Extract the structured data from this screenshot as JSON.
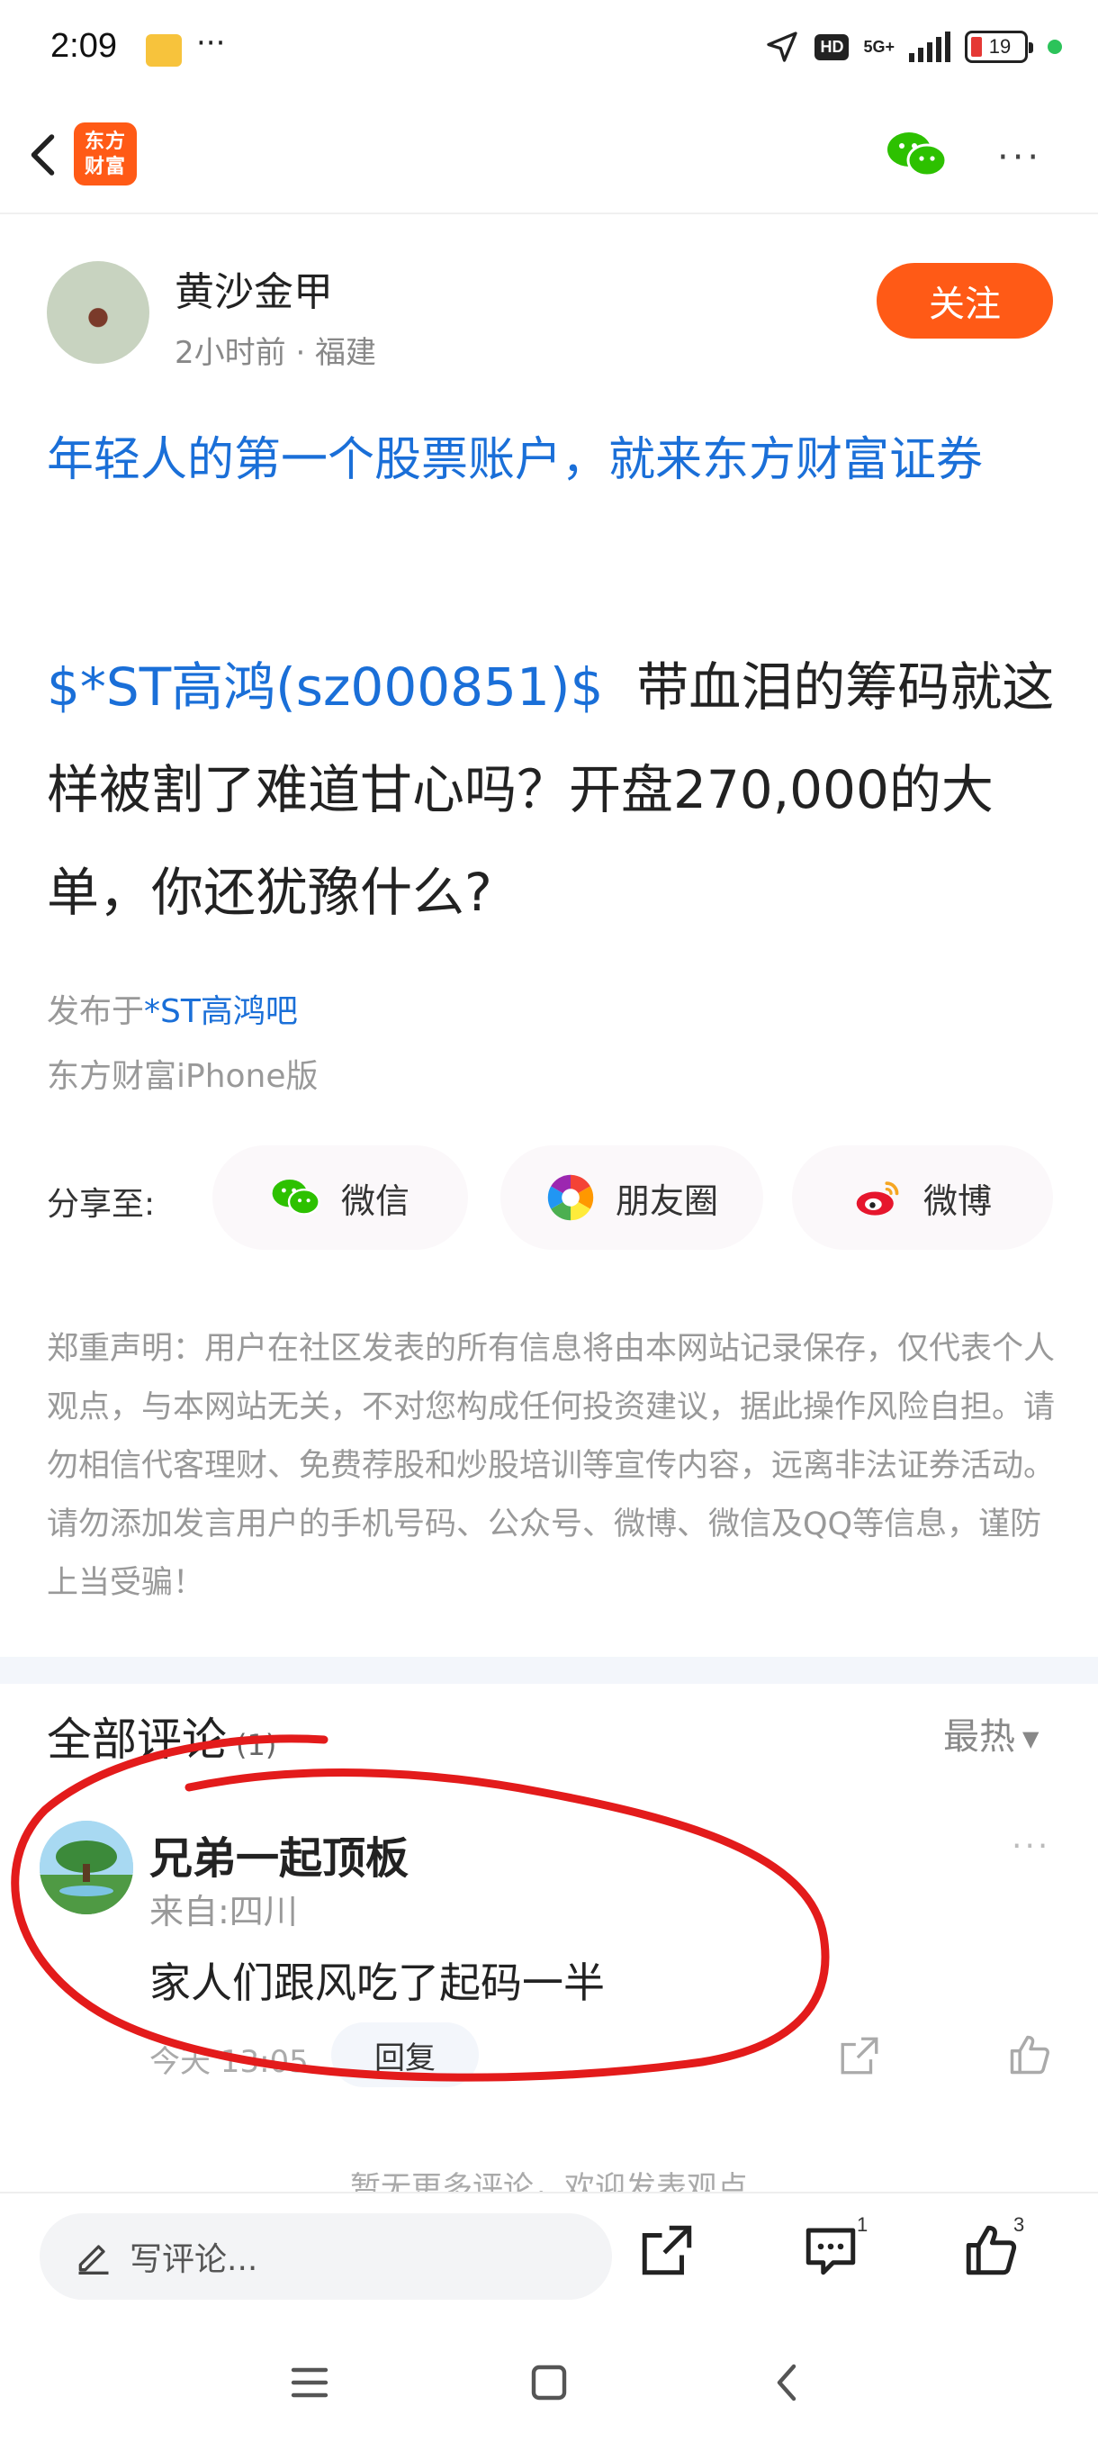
{
  "status_bar": {
    "time": "2:09",
    "dots": "···",
    "network": "5G+",
    "hd": "HD",
    "battery": "19"
  },
  "header": {
    "logo_text": "东方财富",
    "logo_line1": "东方",
    "logo_line2": "财富"
  },
  "post": {
    "author": "黄沙金甲",
    "meta": "2小时前 · 福建",
    "follow_label": "关注",
    "ad_title": "年轻人的第一个股票账户，就来东方财富证券",
    "stock_tag": "$*ST高鸿(sz000851)$",
    "body_text": "带血泪的筹码就这样被割了难道甘心吗？开盘270,000的大单，你还犹豫什么?",
    "published_prefix": "发布于",
    "published_bar": "*ST高鸿吧",
    "client": "东方财富iPhone版"
  },
  "share": {
    "label": "分享至:",
    "wechat": "微信",
    "moments": "朋友圈",
    "weibo": "微博"
  },
  "disclaimer": "郑重声明：用户在社区发表的所有信息将由本网站记录保存，仅代表个人观点，与本网站无关，不对您构成任何投资建议，据此操作风险自担。请勿相信代客理财、免费荐股和炒股培训等宣传内容，远离非法证券活动。请勿添加发言用户的手机号码、公众号、微博、微信及QQ等信息，谨防上当受骗！",
  "comments": {
    "title": "全部评论",
    "count": "(1)",
    "sort": "最热",
    "items": [
      {
        "name": "兄弟一起顶板",
        "location": "来自:四川",
        "text": "家人们跟风吃了起码一半",
        "time": "今天 13:05",
        "reply_label": "回复"
      }
    ],
    "no_more": "暂无更多评论，欢迎发表观点"
  },
  "bottom_bar": {
    "input_placeholder": "写评论...",
    "comment_count": "1",
    "like_count": "3"
  },
  "colors": {
    "brand": "#ff5a16",
    "link": "#1a6fd8",
    "annotation": "#e31b1b"
  }
}
